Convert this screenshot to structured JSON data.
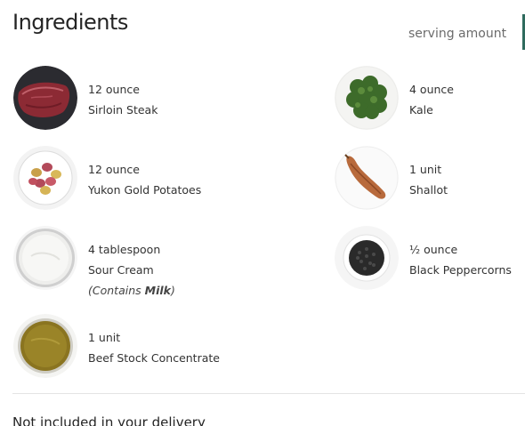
{
  "header": {
    "title": "Ingredients",
    "serving_label": "serving amount"
  },
  "ingredients": [
    {
      "amount": "12 ounce",
      "name": "Sirloin Steak",
      "icon": "steak-image"
    },
    {
      "amount": "4 ounce",
      "name": "Kale",
      "icon": "kale-image"
    },
    {
      "amount": "12 ounce",
      "name": "Yukon Gold Potatoes",
      "icon": "potatoes-image"
    },
    {
      "amount": "1 unit",
      "name": "Shallot",
      "icon": "shallot-image"
    },
    {
      "amount": "4 tablespoon",
      "name": "Sour Cream",
      "allergen_prefix": "(Contains ",
      "allergen_item": "Milk",
      "allergen_suffix": ")",
      "icon": "sour-cream-image"
    },
    {
      "amount": "½ ounce",
      "name": "Black Peppercorns",
      "icon": "peppercorns-image"
    },
    {
      "amount": "1 unit",
      "name": "Beef Stock Concentrate",
      "icon": "beef-stock-image"
    }
  ],
  "footer": {
    "not_included_label": "Not included in your delivery"
  },
  "colors": {
    "accent": "#2f6b5e",
    "divider": "#e4e4e4",
    "muted_text": "#6b6b6b"
  }
}
